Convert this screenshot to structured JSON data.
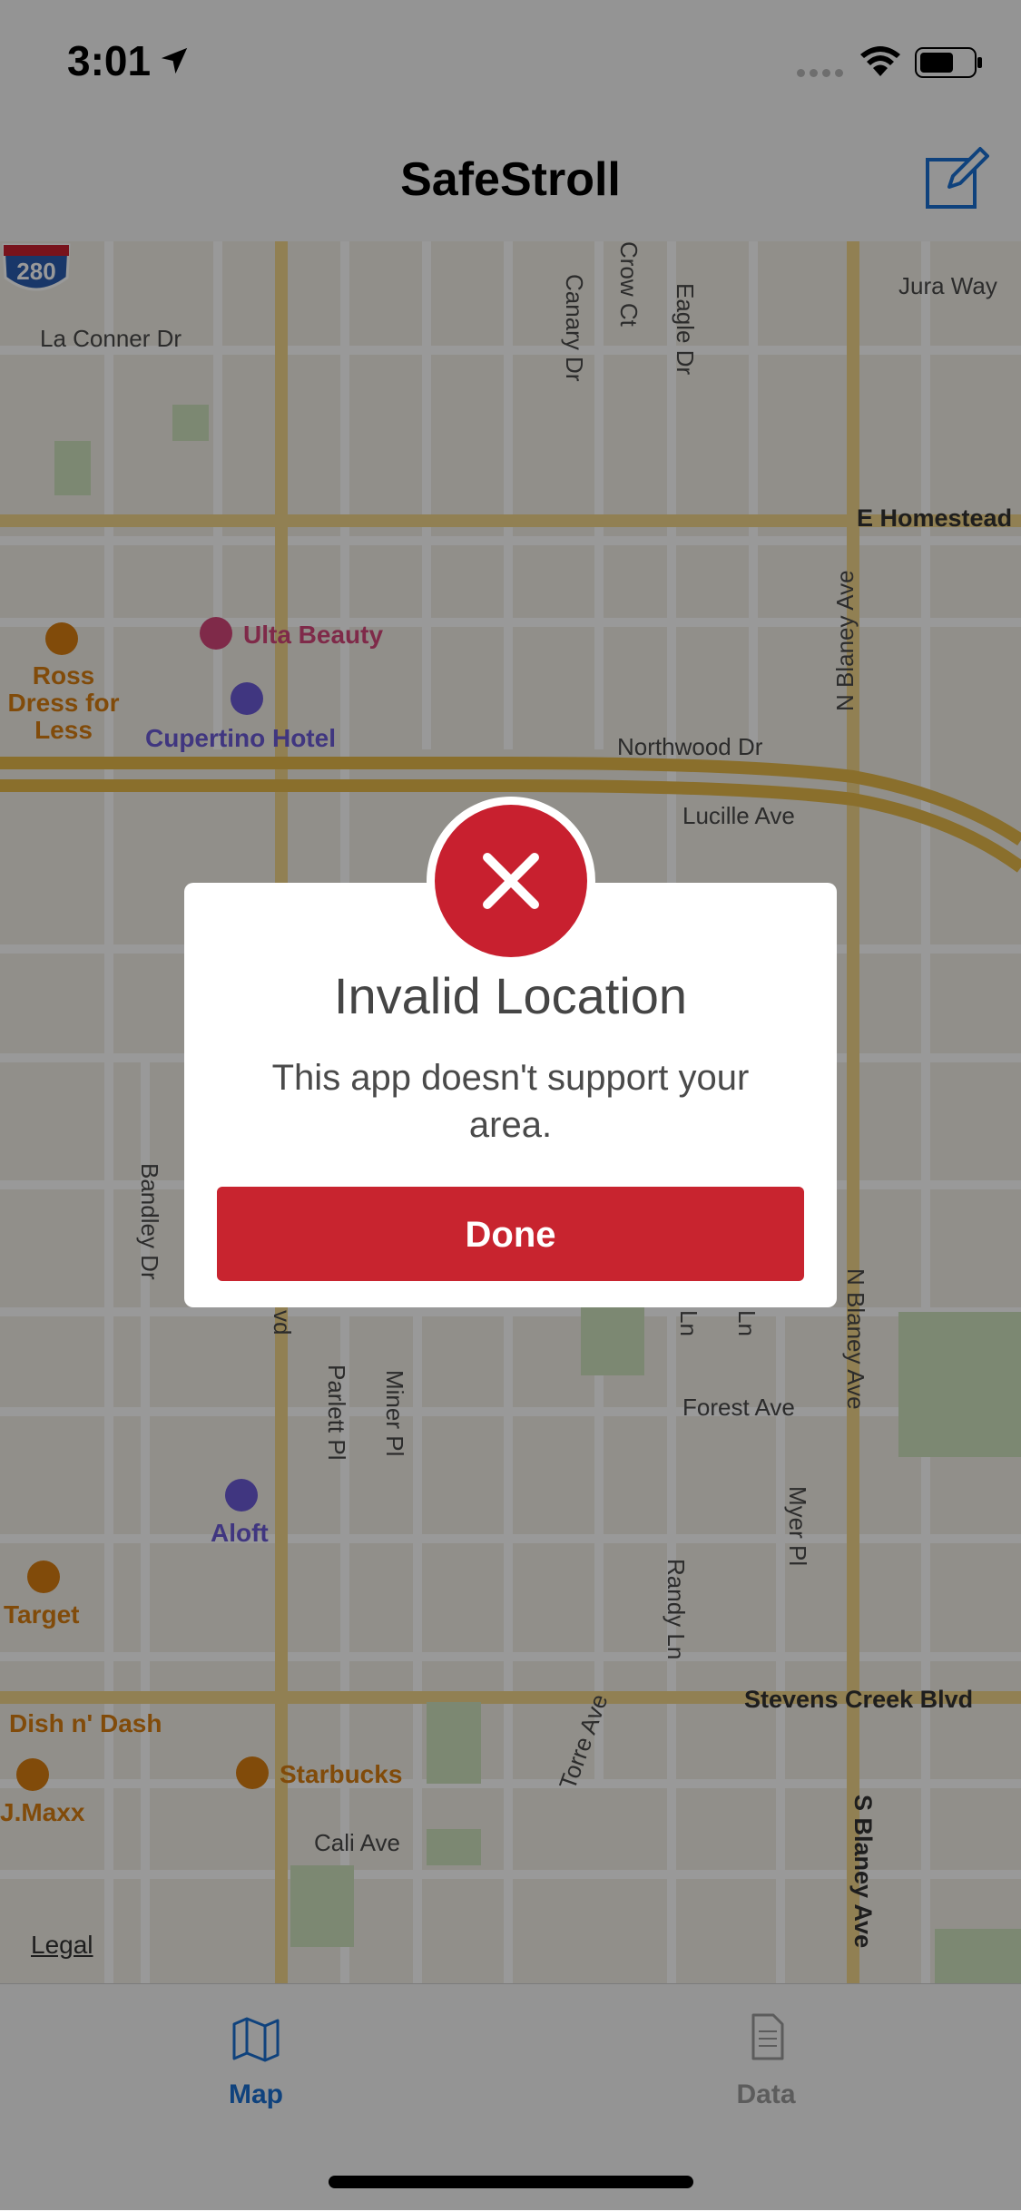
{
  "status_bar": {
    "time": "3:01"
  },
  "nav": {
    "title": "SafeStroll",
    "compose_icon": "compose-icon"
  },
  "map": {
    "streets": {
      "la_conner": "La Conner Dr",
      "canary": "Canary Dr",
      "crow": "Crow Ct",
      "eagle": "Eagle Dr",
      "jura": "Jura Way",
      "homestead": "E Homestead",
      "n_blaney_1": "N Blaney Ave",
      "northwood": "Northwood Dr",
      "lucille": "Lucille Ave",
      "bandley": "Bandley Dr",
      "parlett": "Parlett Pl",
      "miner": "Miner Pl",
      "forest": "Forest Ave",
      "n_blaney_2": "N Blaney Ave",
      "myer": "Myer Pl",
      "randy": "Randy Ln",
      "stevens_creek": "Stevens Creek Blvd",
      "torre": "Torre Ave",
      "cali": "Cali Ave",
      "s_blaney": "S Blaney Ave",
      "vd": "vd",
      "ln1": "Ln",
      "ln2": "Ln"
    },
    "pois": {
      "ulta": "Ulta Beauty",
      "ross": "Ross Dress for Less",
      "cupertino_hotel": "Cupertino Hotel",
      "aloft": "Aloft",
      "target": "Target",
      "dish": "Dish n' Dash",
      "tjmaxx": "J.Maxx",
      "starbucks": "Starbucks"
    },
    "highway_shield": "280",
    "legal": "Legal"
  },
  "alert": {
    "title": "Invalid Location",
    "message": "This app doesn't support your area.",
    "button": "Done",
    "icon": "close-icon"
  },
  "tabs": [
    {
      "label": "Map",
      "icon": "map-icon",
      "active": true
    },
    {
      "label": "Data",
      "icon": "document-icon",
      "active": false
    }
  ],
  "colors": {
    "brand_red": "#c8242f",
    "tab_active": "#1a6fd0",
    "tab_inactive": "#9a9a9a"
  }
}
